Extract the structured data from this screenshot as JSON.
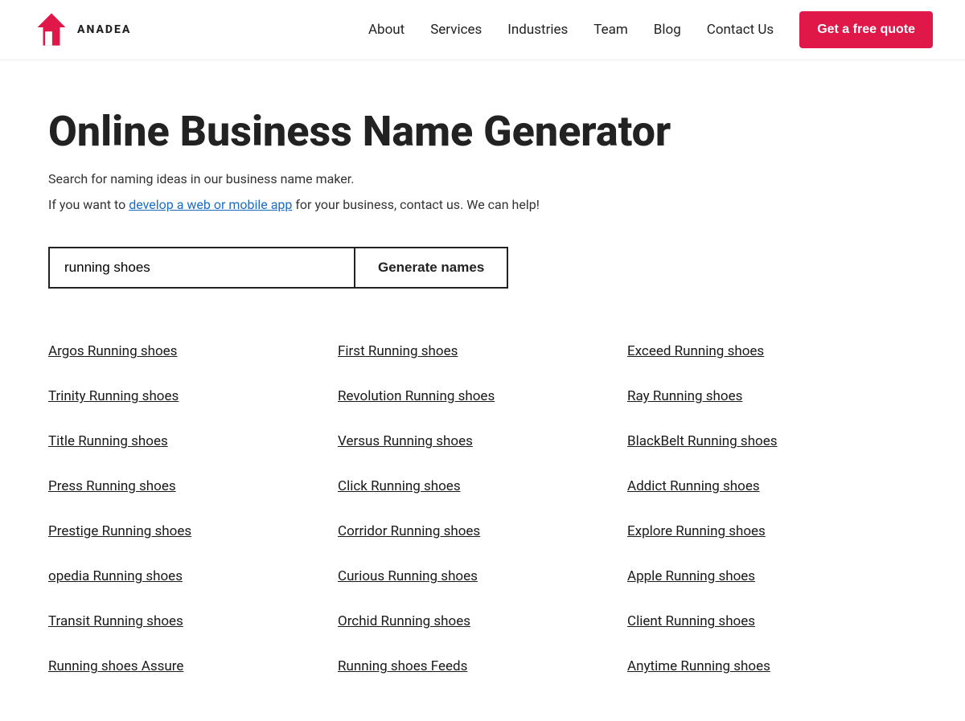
{
  "header": {
    "logo_text": "ANADEA",
    "nav": {
      "about": "About",
      "services": "Services",
      "industries": "Industries",
      "team": "Team",
      "blog": "Blog",
      "contact": "Contact Us"
    },
    "cta_label": "Get a free quote"
  },
  "main": {
    "title": "Online Business Name Generator",
    "subtitle1": "Search for naming ideas in our business name maker.",
    "subtitle2_prefix": "If you want to ",
    "subtitle2_link": "develop a web or mobile app",
    "subtitle2_suffix": " for your business, contact us. We can help!",
    "search": {
      "placeholder": "running shoes",
      "value": "running shoes",
      "button_label": "Generate names"
    }
  },
  "results": {
    "columns": [
      [
        "Argos Running shoes",
        "Trinity Running shoes",
        "Title Running shoes",
        "Press Running shoes",
        "Prestige Running shoes",
        "opedia Running shoes",
        "Transit Running shoes",
        "Running shoes Assure"
      ],
      [
        "First Running shoes",
        "Revolution Running shoes",
        "Versus Running shoes",
        "Click Running shoes",
        "Corridor Running shoes",
        "Curious Running shoes",
        "Orchid Running shoes",
        "Running shoes Feeds"
      ],
      [
        "Exceed Running shoes",
        "Ray Running shoes",
        "BlackBelt Running shoes",
        "Addict Running shoes",
        "Explore Running shoes",
        "Apple Running shoes",
        "Client Running shoes",
        "Anytime Running shoes"
      ]
    ]
  }
}
